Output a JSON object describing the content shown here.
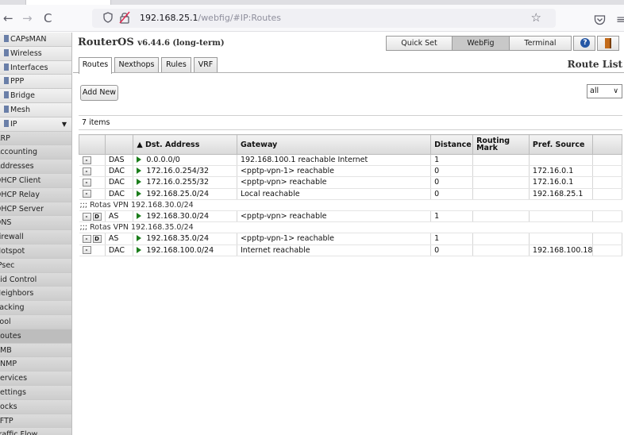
{
  "browser": {
    "url_host": "192.168.25.1",
    "url_path": "/webfig/#IP:Routes",
    "back": "←",
    "forward": "→",
    "reload": "C",
    "star": "☆",
    "menu": "≡"
  },
  "sidebar": {
    "items": [
      {
        "label": "CAPsMAN",
        "kind": "top"
      },
      {
        "label": "Wireless",
        "kind": "top"
      },
      {
        "label": "Interfaces",
        "kind": "top"
      },
      {
        "label": "PPP",
        "kind": "top"
      },
      {
        "label": "Bridge",
        "kind": "top"
      },
      {
        "label": "Mesh",
        "kind": "top"
      },
      {
        "label": "IP",
        "kind": "top",
        "arrow": "▼"
      },
      {
        "label": "ARP",
        "kind": "sub"
      },
      {
        "label": "Accounting",
        "kind": "sub"
      },
      {
        "label": "Addresses",
        "kind": "sub"
      },
      {
        "label": "DHCP Client",
        "kind": "sub"
      },
      {
        "label": "DHCP Relay",
        "kind": "sub"
      },
      {
        "label": "DHCP Server",
        "kind": "sub"
      },
      {
        "label": "DNS",
        "kind": "sub"
      },
      {
        "label": "Firewall",
        "kind": "sub"
      },
      {
        "label": "Hotspot",
        "kind": "sub"
      },
      {
        "label": "IPsec",
        "kind": "sub"
      },
      {
        "label": "Kid Control",
        "kind": "sub"
      },
      {
        "label": "Neighbors",
        "kind": "sub"
      },
      {
        "label": "Packing",
        "kind": "sub"
      },
      {
        "label": "Pool",
        "kind": "sub"
      },
      {
        "label": "Routes",
        "kind": "sub",
        "active": true
      },
      {
        "label": "SMB",
        "kind": "sub"
      },
      {
        "label": "SNMP",
        "kind": "sub"
      },
      {
        "label": "Services",
        "kind": "sub"
      },
      {
        "label": "Settings",
        "kind": "sub"
      },
      {
        "label": "Socks",
        "kind": "sub"
      },
      {
        "label": "TFTP",
        "kind": "sub"
      },
      {
        "label": "Traffic Flow",
        "kind": "sub"
      }
    ]
  },
  "header": {
    "brand": "RouterOS",
    "version": "v6.44.6 (long-term)",
    "quick_set": "Quick Set",
    "webfig": "WebFig",
    "terminal": "Terminal",
    "help": "?"
  },
  "tabs": [
    "Routes",
    "Nexthops",
    "Rules",
    "VRF"
  ],
  "page_title": "Route List",
  "add_new": "Add New",
  "filter_value": "all",
  "item_count": "7 items",
  "table": {
    "columns": [
      "",
      "",
      "▲ Dst. Address",
      "Gateway",
      "Distance",
      "Routing Mark",
      "Pref. Source",
      ""
    ],
    "rows": [
      {
        "type": "route",
        "buttons": [
          "-"
        ],
        "flags": "DAS",
        "dst": "0.0.0.0/0",
        "gateway": "192.168.100.1 reachable Internet",
        "distance": "1",
        "mark": "",
        "pref": ""
      },
      {
        "type": "route",
        "buttons": [
          "-"
        ],
        "flags": "DAC",
        "dst": "172.16.0.254/32",
        "gateway": "<pptp-vpn-1> reachable",
        "distance": "0",
        "mark": "",
        "pref": "172.16.0.1"
      },
      {
        "type": "route",
        "buttons": [
          "-"
        ],
        "flags": "DAC",
        "dst": "172.16.0.255/32",
        "gateway": "<pptp-vpn> reachable",
        "distance": "0",
        "mark": "",
        "pref": "172.16.0.1"
      },
      {
        "type": "route",
        "buttons": [
          "-"
        ],
        "flags": "DAC",
        "dst": "192.168.25.0/24",
        "gateway": "Local reachable",
        "distance": "0",
        "mark": "",
        "pref": "192.168.25.1"
      },
      {
        "type": "comment",
        "text": ";;; Rotas VPN 192.168.30.0/24"
      },
      {
        "type": "route",
        "buttons": [
          "-",
          "D"
        ],
        "flags": "AS",
        "dst": "192.168.30.0/24",
        "gateway": "<pptp-vpn> reachable",
        "distance": "1",
        "mark": "",
        "pref": ""
      },
      {
        "type": "comment",
        "text": ";;; Rotas VPN 192.168.35.0/24"
      },
      {
        "type": "route",
        "buttons": [
          "-",
          "D"
        ],
        "flags": "AS",
        "dst": "192.168.35.0/24",
        "gateway": "<pptp-vpn-1> reachable",
        "distance": "1",
        "mark": "",
        "pref": ""
      },
      {
        "type": "route",
        "buttons": [
          "-"
        ],
        "flags": "DAC",
        "dst": "192.168.100.0/24",
        "gateway": "Internet reachable",
        "distance": "0",
        "mark": "",
        "pref": "192.168.100.18"
      }
    ]
  }
}
